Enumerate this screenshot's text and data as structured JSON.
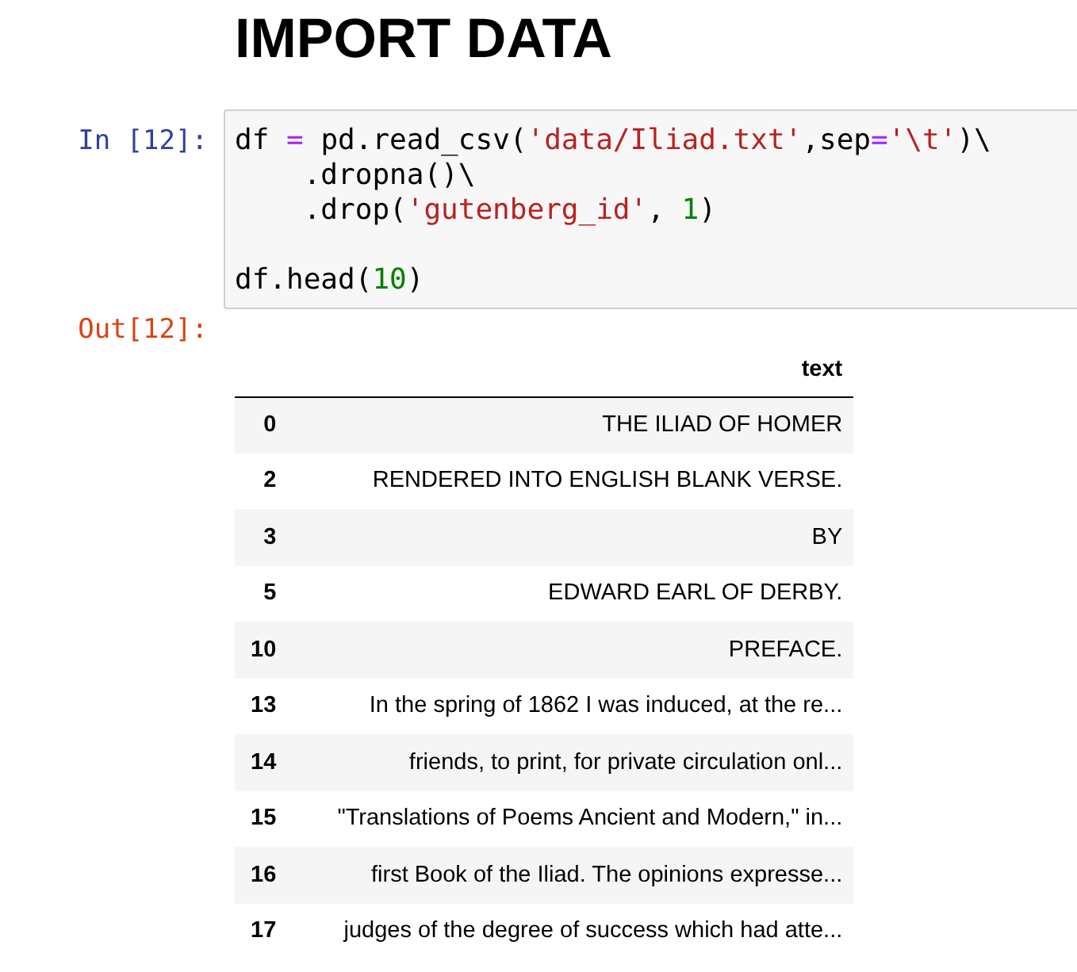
{
  "heading": "IMPORT DATA",
  "input_cell": {
    "prompt": "In [12]:",
    "statements": [
      {
        "lines": [
          [
            {
              "kind": "plain",
              "text": "df "
            },
            {
              "kind": "operator",
              "text": "="
            },
            {
              "kind": "plain",
              "text": " pd.read_csv("
            },
            {
              "kind": "string",
              "text": "'data/Iliad.txt'"
            },
            {
              "kind": "plain",
              "text": ",sep"
            },
            {
              "kind": "operator",
              "text": "="
            },
            {
              "kind": "string",
              "text": "'\\t'"
            },
            {
              "kind": "plain",
              "text": ")\\"
            }
          ],
          [
            {
              "kind": "plain",
              "text": "    .dropna()\\"
            }
          ],
          [
            {
              "kind": "plain",
              "text": "    .drop("
            },
            {
              "kind": "string",
              "text": "'gutenberg_id'"
            },
            {
              "kind": "plain",
              "text": ", "
            },
            {
              "kind": "number",
              "text": "1"
            },
            {
              "kind": "plain",
              "text": ")"
            }
          ]
        ]
      },
      {
        "lines": [
          [
            {
              "kind": "plain",
              "text": "df.head("
            },
            {
              "kind": "number",
              "text": "10"
            },
            {
              "kind": "plain",
              "text": ")"
            }
          ]
        ]
      }
    ]
  },
  "output_cell": {
    "prompt": "Out[12]:",
    "table": {
      "columns": [
        "text"
      ],
      "rows": [
        {
          "index": "0",
          "text": "THE ILIAD OF HOMER"
        },
        {
          "index": "2",
          "text": "RENDERED INTO ENGLISH BLANK VERSE."
        },
        {
          "index": "3",
          "text": "BY"
        },
        {
          "index": "5",
          "text": "EDWARD EARL OF DERBY."
        },
        {
          "index": "10",
          "text": "PREFACE."
        },
        {
          "index": "13",
          "text": "In the spring of 1862 I was induced, at the re..."
        },
        {
          "index": "14",
          "text": "friends, to print, for private circulation onl..."
        },
        {
          "index": "15",
          "text": "\"Translations of Poems Ancient and Modern,\" in..."
        },
        {
          "index": "16",
          "text": "first Book of the Iliad. The opinions expresse..."
        },
        {
          "index": "17",
          "text": "judges of the degree of success which had atte..."
        }
      ]
    }
  }
}
